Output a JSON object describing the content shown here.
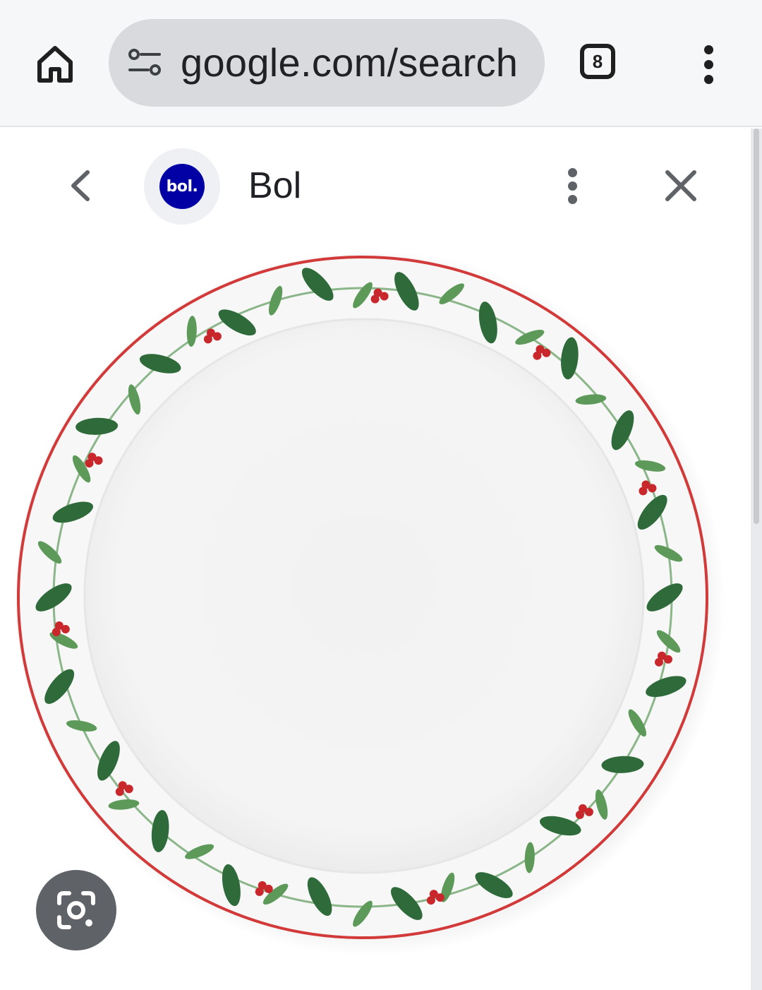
{
  "browser": {
    "url": "google.com/search",
    "tab_count": "8",
    "icons": {
      "home": "home-icon",
      "site_settings": "tune-icon",
      "tabs": "tab-switcher-icon",
      "menu": "more-vert-icon"
    }
  },
  "source_panel": {
    "site_name": "Bol",
    "favicon_text": "bol.",
    "favicon_color": "#0000a4",
    "icons": {
      "back": "chevron-left-icon",
      "menu": "more-vert-icon",
      "close": "close-icon"
    }
  },
  "image": {
    "subject": "plate",
    "colors": {
      "rim": "#d23a3a",
      "leaf": "#2f6b3a",
      "leaf_light": "#5d9a5a",
      "berry": "#c8282c"
    }
  },
  "lens_button": {
    "icon": "lens-icon"
  }
}
